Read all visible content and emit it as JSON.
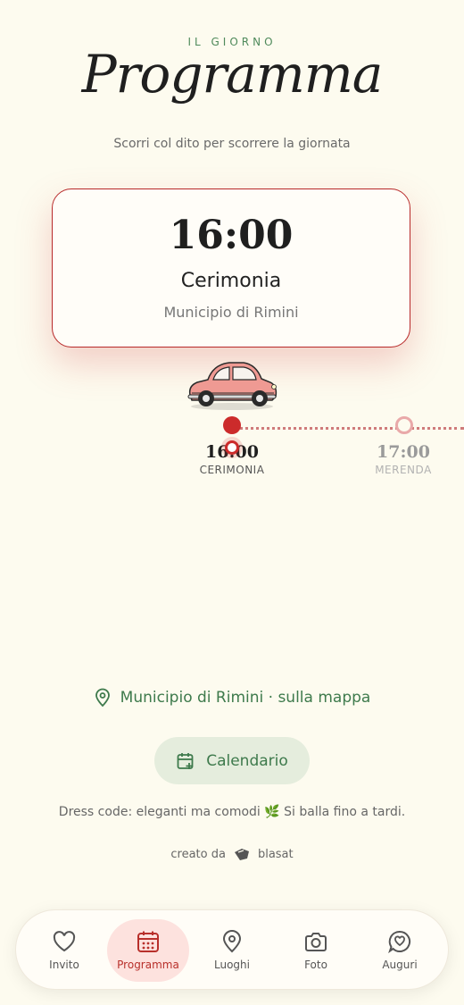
{
  "header": {
    "eyebrow": "IL GIORNO",
    "title": "Programma",
    "subtitle": "Scorri col dito per scorrere la giornata"
  },
  "current_event": {
    "time": "16:00",
    "name": "Cerimonia",
    "place": "Municipio di Rimini"
  },
  "timeline": {
    "stops": [
      {
        "time": "16:00",
        "label": "CERIMONIA",
        "active": true
      },
      {
        "time": "17:00",
        "label": "MERENDA",
        "active": false
      }
    ]
  },
  "location_link": {
    "icon": "map-pin-icon",
    "label": "Municipio di Rimini · sulla mappa"
  },
  "calendar_button": {
    "icon": "calendar-plus-icon",
    "label": "Calendario"
  },
  "dress_code": "Dress code: eleganti ma comodi 🌿 Si balla fino a tardi.",
  "credit": {
    "prefix": "creato da",
    "brand": "blasat"
  },
  "nav": {
    "items": [
      {
        "label": "Invito",
        "icon": "heart-icon",
        "active": false
      },
      {
        "label": "Programma",
        "icon": "calendar-icon",
        "active": true
      },
      {
        "label": "Luoghi",
        "icon": "map-pin-icon",
        "active": false
      },
      {
        "label": "Foto",
        "icon": "camera-icon",
        "active": false
      },
      {
        "label": "Auguri",
        "icon": "heart-message-icon",
        "active": false
      }
    ]
  },
  "colors": {
    "background": "#fdfbef",
    "accent_red": "#cc2b2b",
    "accent_green": "#3e7a4c",
    "car_pink": "#ef9a93"
  }
}
